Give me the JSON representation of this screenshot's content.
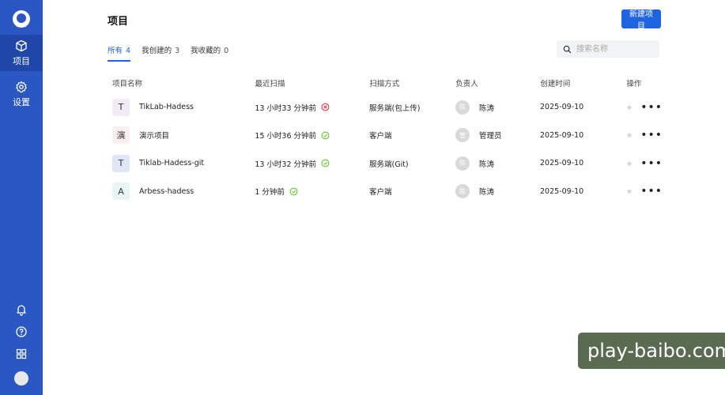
{
  "sidebar": {
    "nav": [
      {
        "label": "项目",
        "icon": "cube-icon",
        "active": true
      },
      {
        "label": "设置",
        "icon": "gear-icon",
        "active": false
      }
    ],
    "bottom_icons": [
      "bell-icon",
      "help-icon",
      "grid-icon",
      "avatar"
    ]
  },
  "header": {
    "title": "项目",
    "new_button": "新建项目"
  },
  "tabs": [
    {
      "label": "所有",
      "count": "4",
      "active": true
    },
    {
      "label": "我创建的",
      "count": "3",
      "active": false
    },
    {
      "label": "我收藏的",
      "count": "0",
      "active": false
    }
  ],
  "search": {
    "placeholder": "搜索名称"
  },
  "table": {
    "columns": [
      "项目名称",
      "最近扫描",
      "扫描方式",
      "负责人",
      "创建时间",
      "操作"
    ],
    "rows": [
      {
        "icon_char": "T",
        "icon_bg": "#f1ebf7",
        "name": "TikLab-Hadess",
        "last_scan": "13 小时33 分钟前",
        "status": "error",
        "method": "服务端(包上传)",
        "avatar_char": "陈",
        "owner": "陈涛",
        "created": "2025-09-10"
      },
      {
        "icon_char": "演",
        "icon_bg": "#fbeeee",
        "name": "演示项目",
        "last_scan": "15 小时36 分钟前",
        "status": "success",
        "method": "客户端",
        "avatar_char": "管",
        "owner": "管理员",
        "created": "2025-09-10"
      },
      {
        "icon_char": "T",
        "icon_bg": "#dfe7f6",
        "name": "Tiklab-Hadess-git",
        "last_scan": "13 小时32 分钟前",
        "status": "success",
        "method": "服务端(Git)",
        "avatar_char": "陈",
        "owner": "陈涛",
        "created": "2025-09-10"
      },
      {
        "icon_char": "A",
        "icon_bg": "#e9f5f3",
        "name": "Arbess-hadess",
        "last_scan": "1 分钟前",
        "status": "success",
        "method": "客户端",
        "avatar_char": "陈",
        "owner": "陈涛",
        "created": "2025-09-10"
      }
    ]
  },
  "watermark": "play-baibo.com",
  "colors": {
    "sidebar": "#2b57c4",
    "accent": "#1e63e0",
    "success": "#52c41a",
    "error": "#f5222d"
  }
}
